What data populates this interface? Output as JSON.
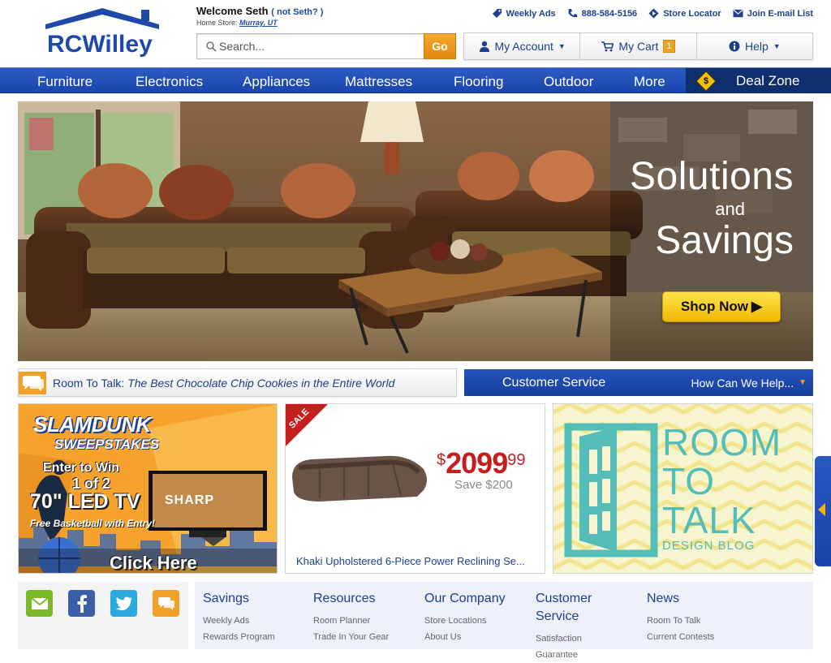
{
  "brand": {
    "name": "RCWilley"
  },
  "welcome": {
    "greeting": "Welcome Seth",
    "not_me": "( not Seth? )",
    "home_store_label": "Home Store:",
    "home_store_city": "Murray, UT"
  },
  "toplinks": [
    {
      "label": "Weekly Ads",
      "icon": "tag-icon"
    },
    {
      "label": "888-584-5156",
      "icon": "phone-icon"
    },
    {
      "label": "Store Locator",
      "icon": "location-icon"
    },
    {
      "label": "Join E-mail List",
      "icon": "envelope-icon"
    }
  ],
  "search": {
    "placeholder": "Search...",
    "go_label": "Go"
  },
  "account_bar": {
    "account_label": "My Account",
    "cart_label": "My Cart",
    "cart_count": "1",
    "help_label": "Help"
  },
  "nav": [
    "Furniture",
    "Electronics",
    "Appliances",
    "Mattresses",
    "Flooring",
    "Outdoor",
    "More",
    "Deal Zone"
  ],
  "deal_icon": "$",
  "hero": {
    "line1": "Solutions",
    "line2": "and",
    "line3": "Savings",
    "cta": "Shop Now"
  },
  "room_strip": {
    "label": "Room To Talk:",
    "title": "The Best Chocolate Chip Cookies in the Entire World"
  },
  "customer_service": {
    "title": "Customer Service",
    "help": "How Can We Help..."
  },
  "promo_slam": {
    "line1": "SLAMDUNK",
    "line2": "SWEEPSTAKES",
    "line3": "Enter to Win",
    "line4": "1 of 2",
    "line5": "70\" LED TV",
    "line6": "Free Basketball with Entry!",
    "tv_brand": "SHARP",
    "cta": "Click Here"
  },
  "promo_sale": {
    "ribbon": "SALE",
    "currency": "$",
    "price": "2099",
    "cents": "99",
    "save": "Save $200",
    "product": "Khaki Upholstered 6-Piece Power Reclining Se..."
  },
  "promo_blog": {
    "line1": "ROOM",
    "line2": "TO",
    "line3": "TALK",
    "sub": "DESIGN BLOG"
  },
  "footer": {
    "columns": [
      {
        "heading": "Savings",
        "links": [
          "Weekly Ads",
          "Rewards Program"
        ]
      },
      {
        "heading": "Resources",
        "links": [
          "Room Planner",
          "Trade In Your Gear"
        ]
      },
      {
        "heading": "Our Company",
        "links": [
          "Store Locations",
          "About Us"
        ]
      },
      {
        "heading": "Customer Service",
        "links": [
          "Satisfaction Guarantee"
        ]
      },
      {
        "heading": "News",
        "links": [
          "Room To Talk",
          "Current Contests"
        ]
      }
    ]
  },
  "colors": {
    "brand_blue": "#1d49a8",
    "nav_blue": "#1f4fb8",
    "accent_orange": "#f0a128",
    "sale_red": "#c61d1d"
  }
}
